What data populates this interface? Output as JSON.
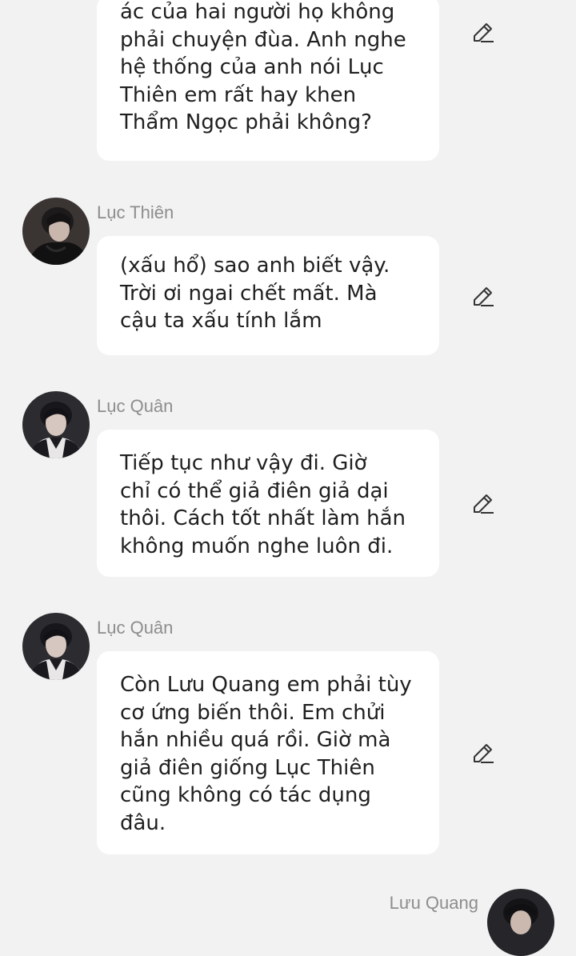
{
  "messages": [
    {
      "text": "ác của hai người họ không\nphải chuyện đùa. Anh nghe\nhệ thống của anh nói Lục\nThiên em rất hay khen\nThẩm Ngọc phải không?"
    },
    {
      "sender": "Lục Thiên",
      "avatar_icon": "avatar-luc-thien",
      "text": "(xấu hổ) sao anh biết vậy.\nTrời ơi ngai chết mất. Mà\ncậu ta xấu tính lắm"
    },
    {
      "sender": "Lục Quân",
      "avatar_icon": "avatar-luc-quan",
      "text": "Tiếp tục như vậy đi. Giờ\nchỉ có thể giả điên giả dại\nthôi. Cách tốt nhất làm hắn\nkhông muốn nghe luôn đi."
    },
    {
      "sender": "Lục Quân",
      "avatar_icon": "avatar-luc-quan",
      "text": "Còn Lưu Quang em phải tùy\ncơ ứng biến thôi. Em chửi\nhắn nhiều quá rồi. Giờ mà\ngiả điên giống Lục Thiên\ncũng không có tác dụng\nđâu."
    },
    {
      "sender": "Lưu Quang",
      "avatar_icon": "avatar-luu-quang"
    }
  ],
  "icons": {
    "edit": "pencil-edit-icon"
  },
  "colors": {
    "background": "#f2f2f3",
    "bubble": "#ffffff",
    "text": "#1f1f1f",
    "sender": "#8d8d8d"
  }
}
